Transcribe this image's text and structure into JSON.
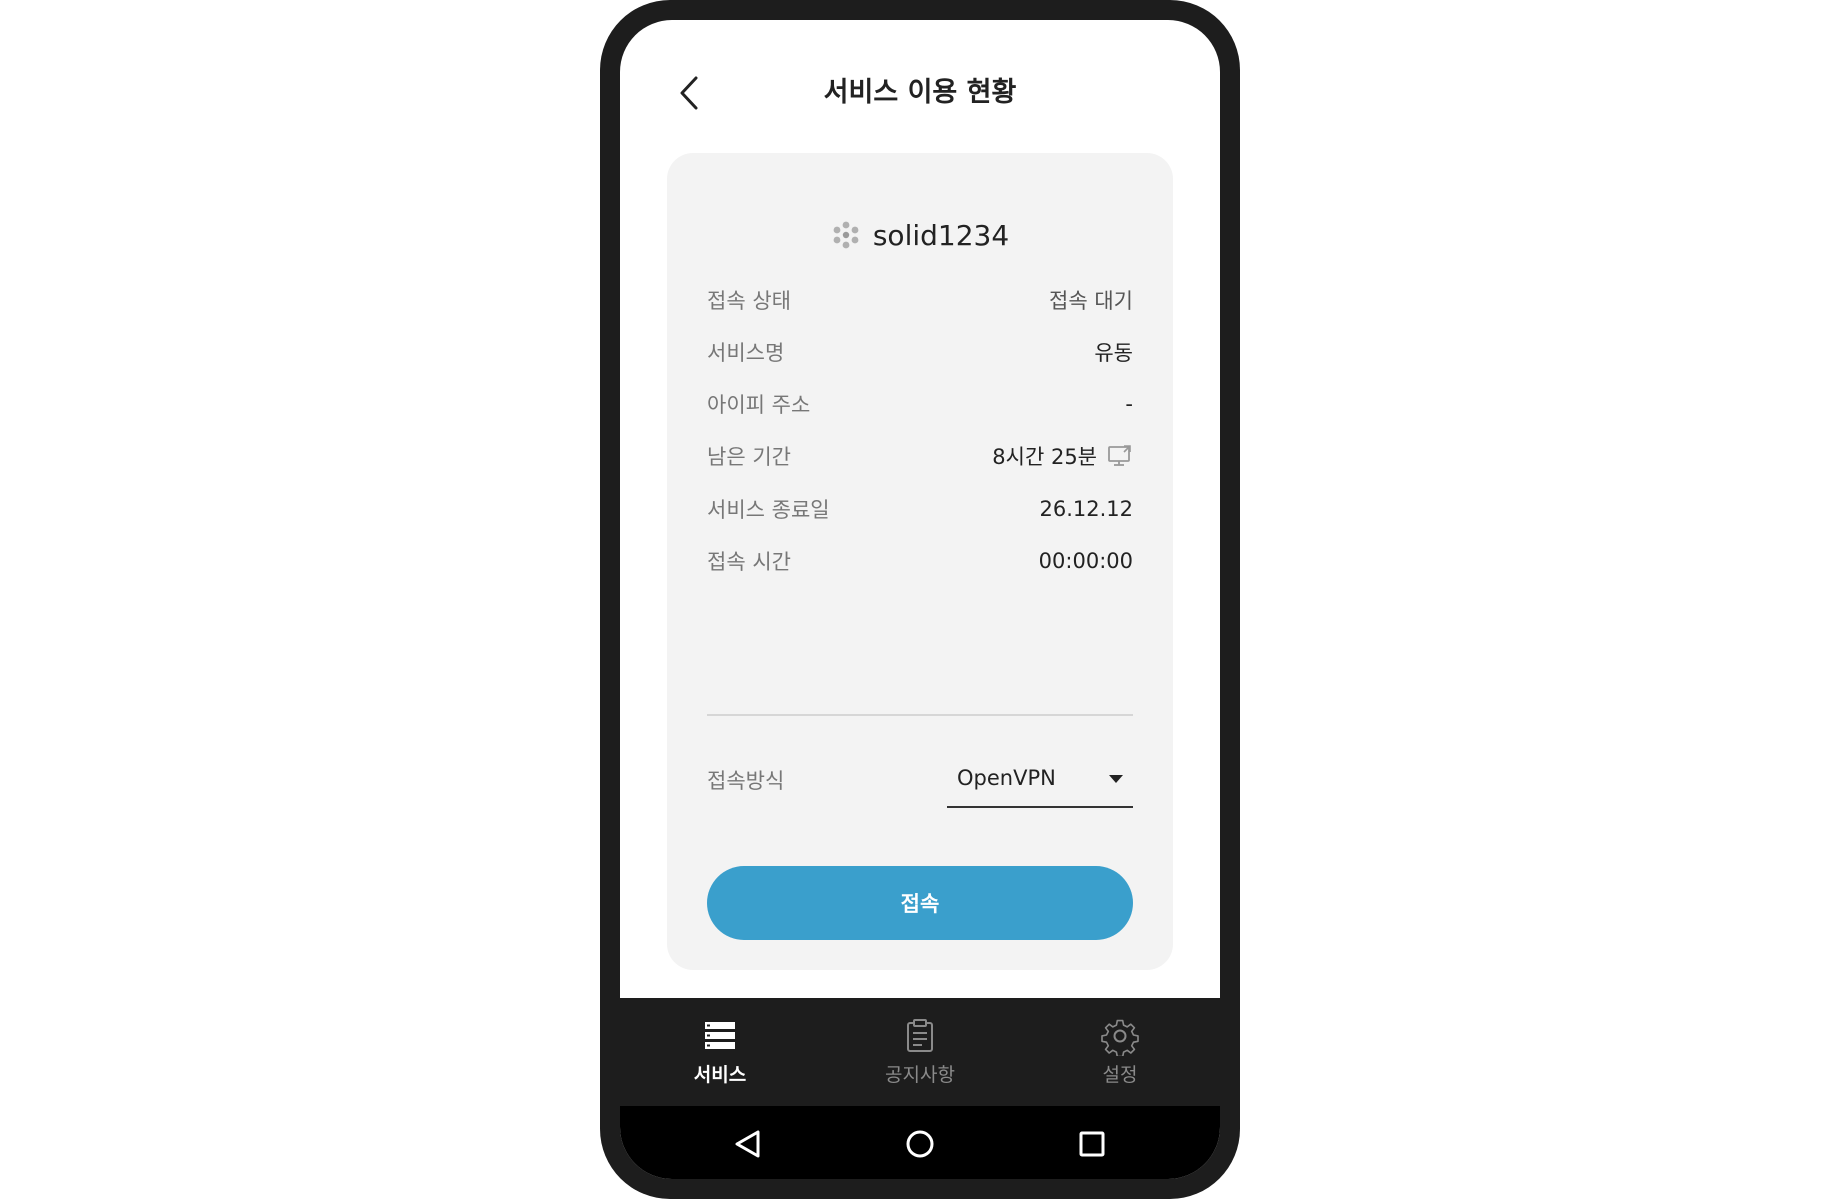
{
  "header": {
    "title": "서비스 이용 현황",
    "back_icon": "chevron-left-icon"
  },
  "account": {
    "icon": "cluster-icon",
    "username": "solid1234"
  },
  "info": [
    {
      "label": "접속 상태",
      "value": "접속 대기"
    },
    {
      "label": "서비스명",
      "value": "유동"
    },
    {
      "label": "아이피 주소",
      "value": "-"
    },
    {
      "label": "남은 기간",
      "value": "8시간 25분",
      "icon": "monitor-icon"
    },
    {
      "label": "서비스 종료일",
      "value": "26.12.12"
    },
    {
      "label": "접속 시간",
      "value": "00:00:00"
    }
  ],
  "connection_method": {
    "label": "접속방식",
    "selected": "OpenVPN"
  },
  "connect_button": {
    "label": "접속",
    "color": "#3a9fcc"
  },
  "tabs": [
    {
      "label": "서비스",
      "icon": "server-list-icon",
      "active": true
    },
    {
      "label": "공지사항",
      "icon": "clipboard-icon",
      "active": false
    },
    {
      "label": "설정",
      "icon": "gear-icon",
      "active": false
    }
  ],
  "system_nav": [
    "back-triangle-icon",
    "home-circle-icon",
    "recents-square-icon"
  ]
}
